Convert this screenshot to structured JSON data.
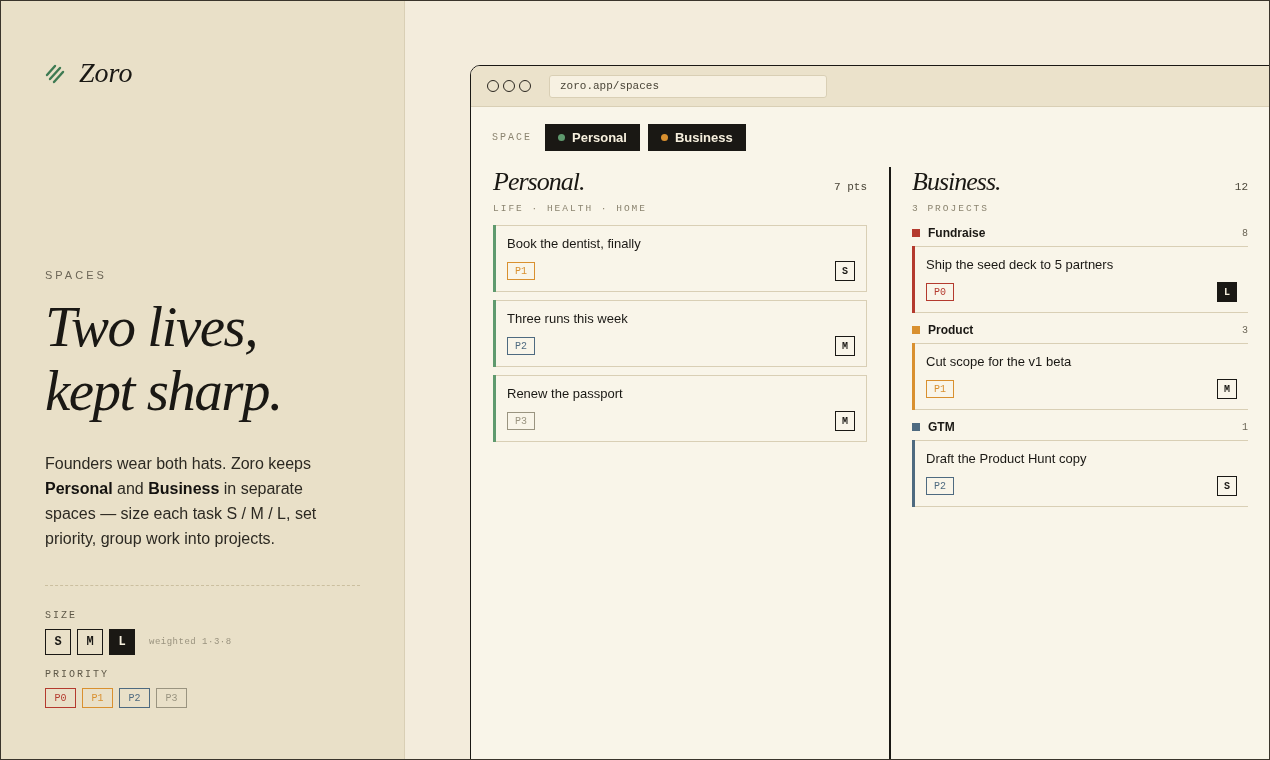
{
  "brand": {
    "name": "Zoro"
  },
  "hero": {
    "eyebrow": "SPACES",
    "title_lines": [
      "Two lives,",
      "kept sharp."
    ],
    "body": "Founders wear both hats. Zoro keeps **Personal** and **Business** in separate spaces — size each task S / M / L, set priority, group work into projects."
  },
  "size_legend": {
    "label": "SIZE",
    "items": [
      {
        "label": "S",
        "filled": false
      },
      {
        "label": "M",
        "filled": false
      },
      {
        "label": "L",
        "filled": true
      }
    ],
    "note": "weighted 1·3·8"
  },
  "priority_legend": {
    "label": "PRIORITY",
    "items": [
      {
        "label": "P0",
        "color": "#b43a2e"
      },
      {
        "label": "P1",
        "color": "#d9902f"
      },
      {
        "label": "P2",
        "color": "#4e6a80"
      },
      {
        "label": "P3",
        "color": "#9a9480"
      }
    ]
  },
  "browser": {
    "url": "zoro.app/spaces"
  },
  "space_switch": {
    "label": "SPACE",
    "tabs": [
      {
        "label": "Personal",
        "color": "#5f9a6e"
      },
      {
        "label": "Business",
        "color": "#d9902f"
      }
    ]
  },
  "personal": {
    "title": "Personal.",
    "points": "7 pts",
    "subtitle": "LIFE · HEALTH · HOME",
    "color": "#5f9a6e",
    "tasks": [
      {
        "title": "Book the dentist, finally",
        "priority": {
          "label": "P1",
          "color": "#d9902f"
        },
        "size": {
          "label": "S",
          "filled": false
        }
      },
      {
        "title": "Three runs this week",
        "priority": {
          "label": "P2",
          "color": "#4e6a80"
        },
        "size": {
          "label": "M",
          "filled": false
        }
      },
      {
        "title": "Renew the passport",
        "priority": {
          "label": "P3",
          "color": "#9a9480"
        },
        "size": {
          "label": "M",
          "filled": false
        }
      }
    ]
  },
  "business": {
    "title": "Business.",
    "points": "12",
    "subtitle": "3 PROJECTS",
    "projects": [
      {
        "name": "Fundraise",
        "count": "8",
        "color": "#b43a2e",
        "tasks": [
          {
            "title": "Ship the seed deck to 5 partners",
            "priority": {
              "label": "P0",
              "color": "#b43a2e"
            },
            "size": {
              "label": "L",
              "filled": true
            }
          }
        ]
      },
      {
        "name": "Product",
        "count": "3",
        "color": "#d9902f",
        "tasks": [
          {
            "title": "Cut scope for the v1 beta",
            "priority": {
              "label": "P1",
              "color": "#d9902f"
            },
            "size": {
              "label": "M",
              "filled": false
            }
          }
        ]
      },
      {
        "name": "GTM",
        "count": "1",
        "color": "#4e6a80",
        "tasks": [
          {
            "title": "Draft the Product Hunt copy",
            "priority": {
              "label": "P2",
              "color": "#4e6a80"
            },
            "size": {
              "label": "S",
              "filled": false
            }
          }
        ]
      }
    ]
  }
}
